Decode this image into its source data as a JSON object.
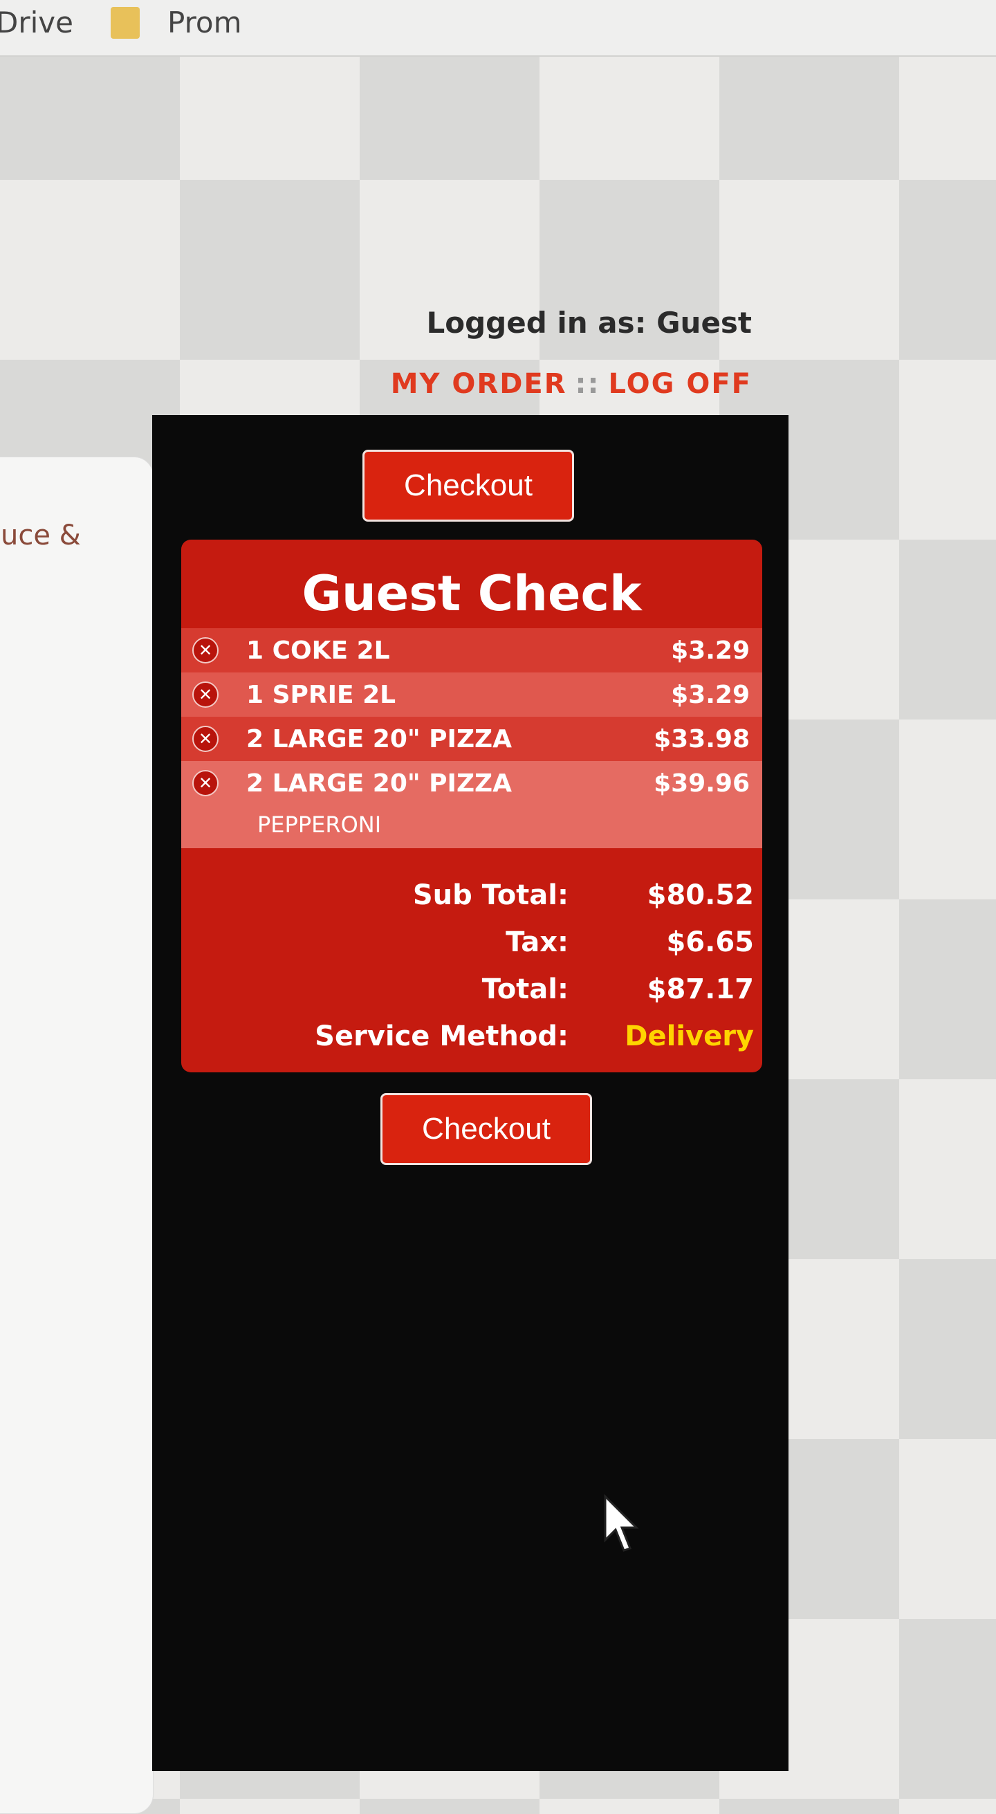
{
  "bookmarks": {
    "drive_label": "Drive",
    "prom_label": "Prom"
  },
  "header": {
    "login_text": "Logged in as: Guest",
    "my_order_label": "MY ORDER",
    "separator": "::",
    "log_off_label": "LOG OFF"
  },
  "left_panel": {
    "partial_text": "uce &"
  },
  "checkout": {
    "top_label": "Checkout",
    "bottom_label": "Checkout"
  },
  "guest_check": {
    "title": "Guest Check",
    "items": [
      {
        "name": "1 COKE 2L",
        "price": "$3.29"
      },
      {
        "name": "1 SPRIE 2L",
        "price": "$3.29"
      },
      {
        "name": "2 LARGE 20\" PIZZA",
        "price": "$33.98"
      },
      {
        "name": "2 LARGE 20\" PIZZA",
        "price": "$39.96",
        "detail": "PEPPERONI"
      }
    ],
    "subtotal_label": "Sub Total:",
    "subtotal_value": "$80.52",
    "tax_label": "Tax:",
    "tax_value": "$6.65",
    "total_label": "Total:",
    "total_value": "$87.17",
    "service_label": "Service Method:",
    "service_value": "Delivery"
  },
  "icons": {
    "remove": "remove-x-icon",
    "folder": "folder-icon",
    "cursor": "mouse-pointer-icon"
  },
  "colors": {
    "accent_red": "#d9230f",
    "check_red": "#c51b10",
    "delivery_yellow": "#ffd400",
    "link_red": "#e03a1f"
  }
}
